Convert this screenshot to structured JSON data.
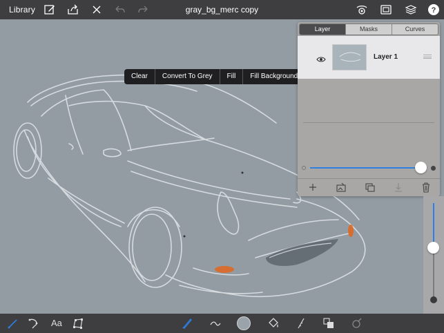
{
  "topbar": {
    "library_label": "Library",
    "title": "gray_bg_merc copy",
    "icons": [
      "edit-icon",
      "share-icon",
      "close-icon",
      "undo-icon",
      "redo-icon",
      "symmetry-icon",
      "canvas-icon",
      "layers-icon",
      "help-icon"
    ]
  },
  "context_menu": {
    "items": [
      "Clear",
      "Convert To Grey",
      "Fill",
      "Fill Background"
    ]
  },
  "layers_panel": {
    "tabs": [
      "Layer",
      "Masks",
      "Curves"
    ],
    "active_tab": "Layer",
    "layers": [
      {
        "name": "Layer 1",
        "visible": true
      }
    ],
    "opacity": 1.0,
    "actions": [
      "add-layer-icon",
      "import-image-icon",
      "duplicate-layer-icon",
      "merge-down-icon",
      "trash-icon"
    ]
  },
  "brush_size_slider": {
    "value": 0.47
  },
  "bottombar": {
    "text_tool_label": "Aa",
    "color_well": "#9aa3aa",
    "tools": [
      "brush-icon",
      "selection-lasso-icon",
      "text-tool-icon",
      "transform-icon",
      "pencil-icon",
      "stroke-icon",
      "color-well",
      "fill-bucket-icon",
      "ruler-icon",
      "stack-icon",
      "mixer-icon"
    ]
  },
  "colors": {
    "toolbar_bg": "#3e3e40",
    "canvas_bg": "#939ca3",
    "accent": "#2d7fe0",
    "orange_mark": "#e0661c"
  }
}
